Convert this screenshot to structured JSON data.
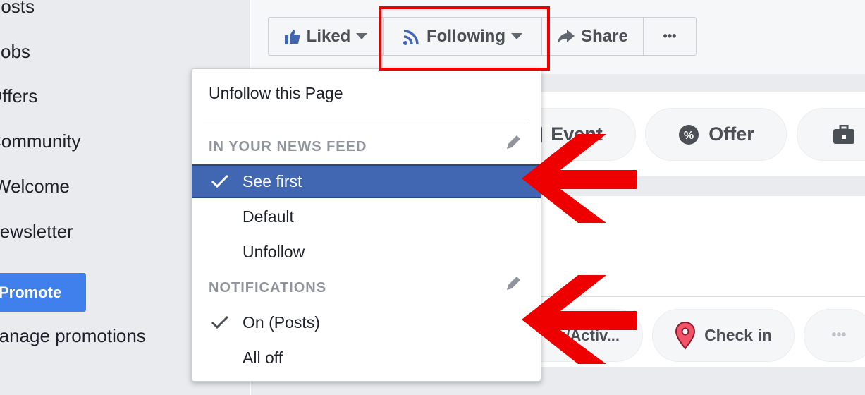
{
  "sidebar": {
    "items": [
      {
        "label": "Posts"
      },
      {
        "label": "Jobs"
      },
      {
        "label": "Offers"
      },
      {
        "label": "Community"
      },
      {
        "label": "Welcome"
      },
      {
        "label": "Newsletter"
      }
    ],
    "promote_label": "Promote",
    "manage_label": "Manage promotions"
  },
  "action_bar": {
    "liked": "Liked",
    "following": "Following",
    "share": "Share",
    "more": "•••"
  },
  "composer": {
    "event": "Event",
    "offer": "Offer",
    "feeling": "g/Activ...",
    "checkin": "Check in",
    "more": "•••"
  },
  "dropdown": {
    "unfollow_page": "Unfollow this Page",
    "news_feed_header": "IN YOUR NEWS FEED",
    "news_feed_options": [
      {
        "label": "See first",
        "selected": true
      },
      {
        "label": "Default",
        "selected": false
      },
      {
        "label": "Unfollow",
        "selected": false
      }
    ],
    "notifications_header": "NOTIFICATIONS",
    "notification_options": [
      {
        "label": "On (Posts)",
        "selected": true
      },
      {
        "label": "All off",
        "selected": false
      }
    ]
  },
  "colors": {
    "accent": "#4267b2",
    "annotation": "#ee0000",
    "promote": "#4080ec"
  }
}
